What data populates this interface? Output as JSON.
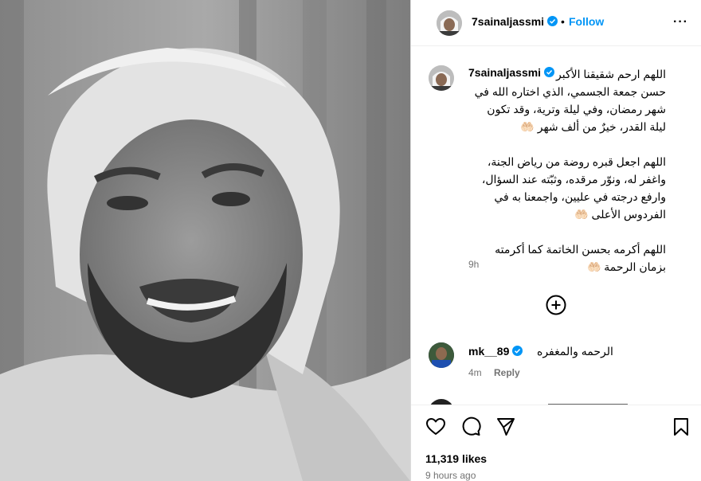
{
  "post": {
    "username": "7sainaljassmi",
    "follow_label": "Follow",
    "dot": "•",
    "more_label": "···",
    "caption": "اللهم ارحم شقيقنا الأكبر\nحسن جمعة الجسمي، الذي اختاره الله في\nشهر رمضان، وفي ليلة وترية، وقد تكون\nليلة القدر، خيرٌ من ألف شهر 🤲🏻\n\nاللهم اجعل قبره روضة من رياض الجنة،\nواغفر له، ونوّر مرقده، وثبّته عند السؤال،\nوارفع درجته في عليين، واجمعنا به في\nالفردوس الأعلى 🤲🏻\n\nاللهم أكرمه بحسن الخاتمة كما أكرمته\nبزمان الرحمة 🤲🏻",
    "caption_time": "9h",
    "likes": "11,319 likes",
    "posted_ago": "9 hours ago"
  },
  "comments": [
    {
      "username": "mk__89",
      "text": "الرحمه والمغفره",
      "time": "4m",
      "reply_label": "Reply"
    }
  ],
  "icons": {
    "verified": "verified-badge-icon",
    "add": "plus-circle-icon",
    "like": "heart-icon",
    "comment": "comment-bubble-icon",
    "share": "paper-plane-icon",
    "save": "bookmark-icon"
  },
  "colors": {
    "accent": "#0095f6",
    "verified": "#0095f6",
    "muted": "#737373"
  }
}
